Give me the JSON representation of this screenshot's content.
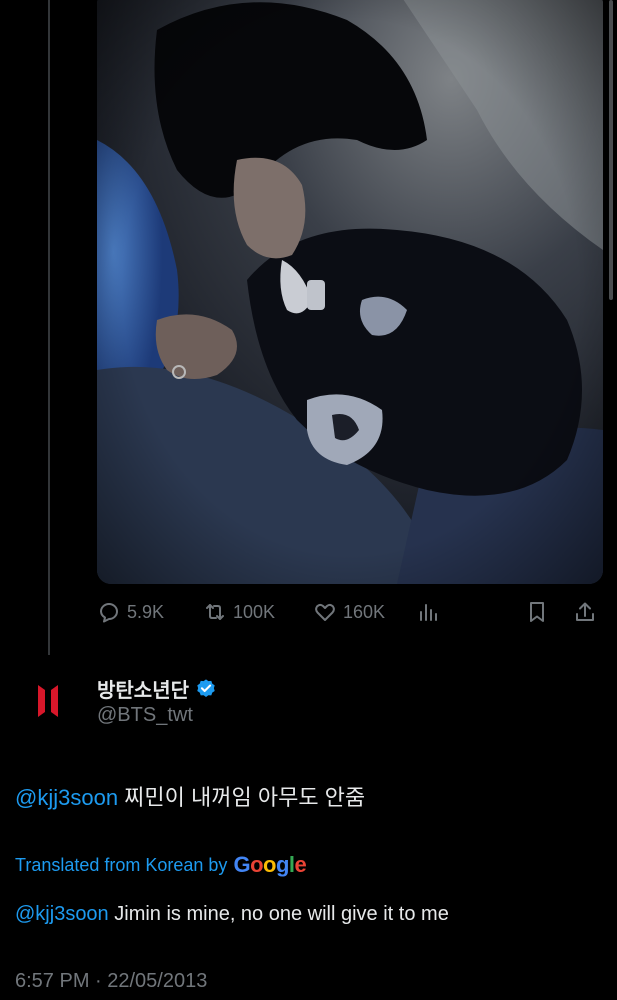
{
  "tweet_media": {
    "photo_icon": "photo-of-sleeping-person-icon"
  },
  "action_bar": {
    "replies": "5.9K",
    "retweets": "100K",
    "likes": "160K",
    "icons": [
      "reply-icon",
      "retweet-icon",
      "like-icon",
      "analytics-icon",
      "bookmark-icon",
      "share-icon"
    ]
  },
  "reply": {
    "display_name": "방탄소년단",
    "verified": true,
    "handle": "@BTS_twt",
    "avatar_icon": "bts-logo-icon",
    "text_mention": "@kjj3soon",
    "text_body": " 찌민이 내꺼임 아무도 안줌",
    "translated_label": "Translated from Korean by",
    "translated_provider": "Google",
    "translation_mention": "@kjj3soon",
    "translation_body": " Jimin is mine, no one will give it to me",
    "timestamp": "6:57 PM · 22/05/2013"
  },
  "colors": {
    "background": "#000000",
    "accent": "#1d9bf0",
    "secondary_text": "#71767b",
    "primary_text": "#e7e9ea",
    "brand_red": "#d7172a"
  }
}
